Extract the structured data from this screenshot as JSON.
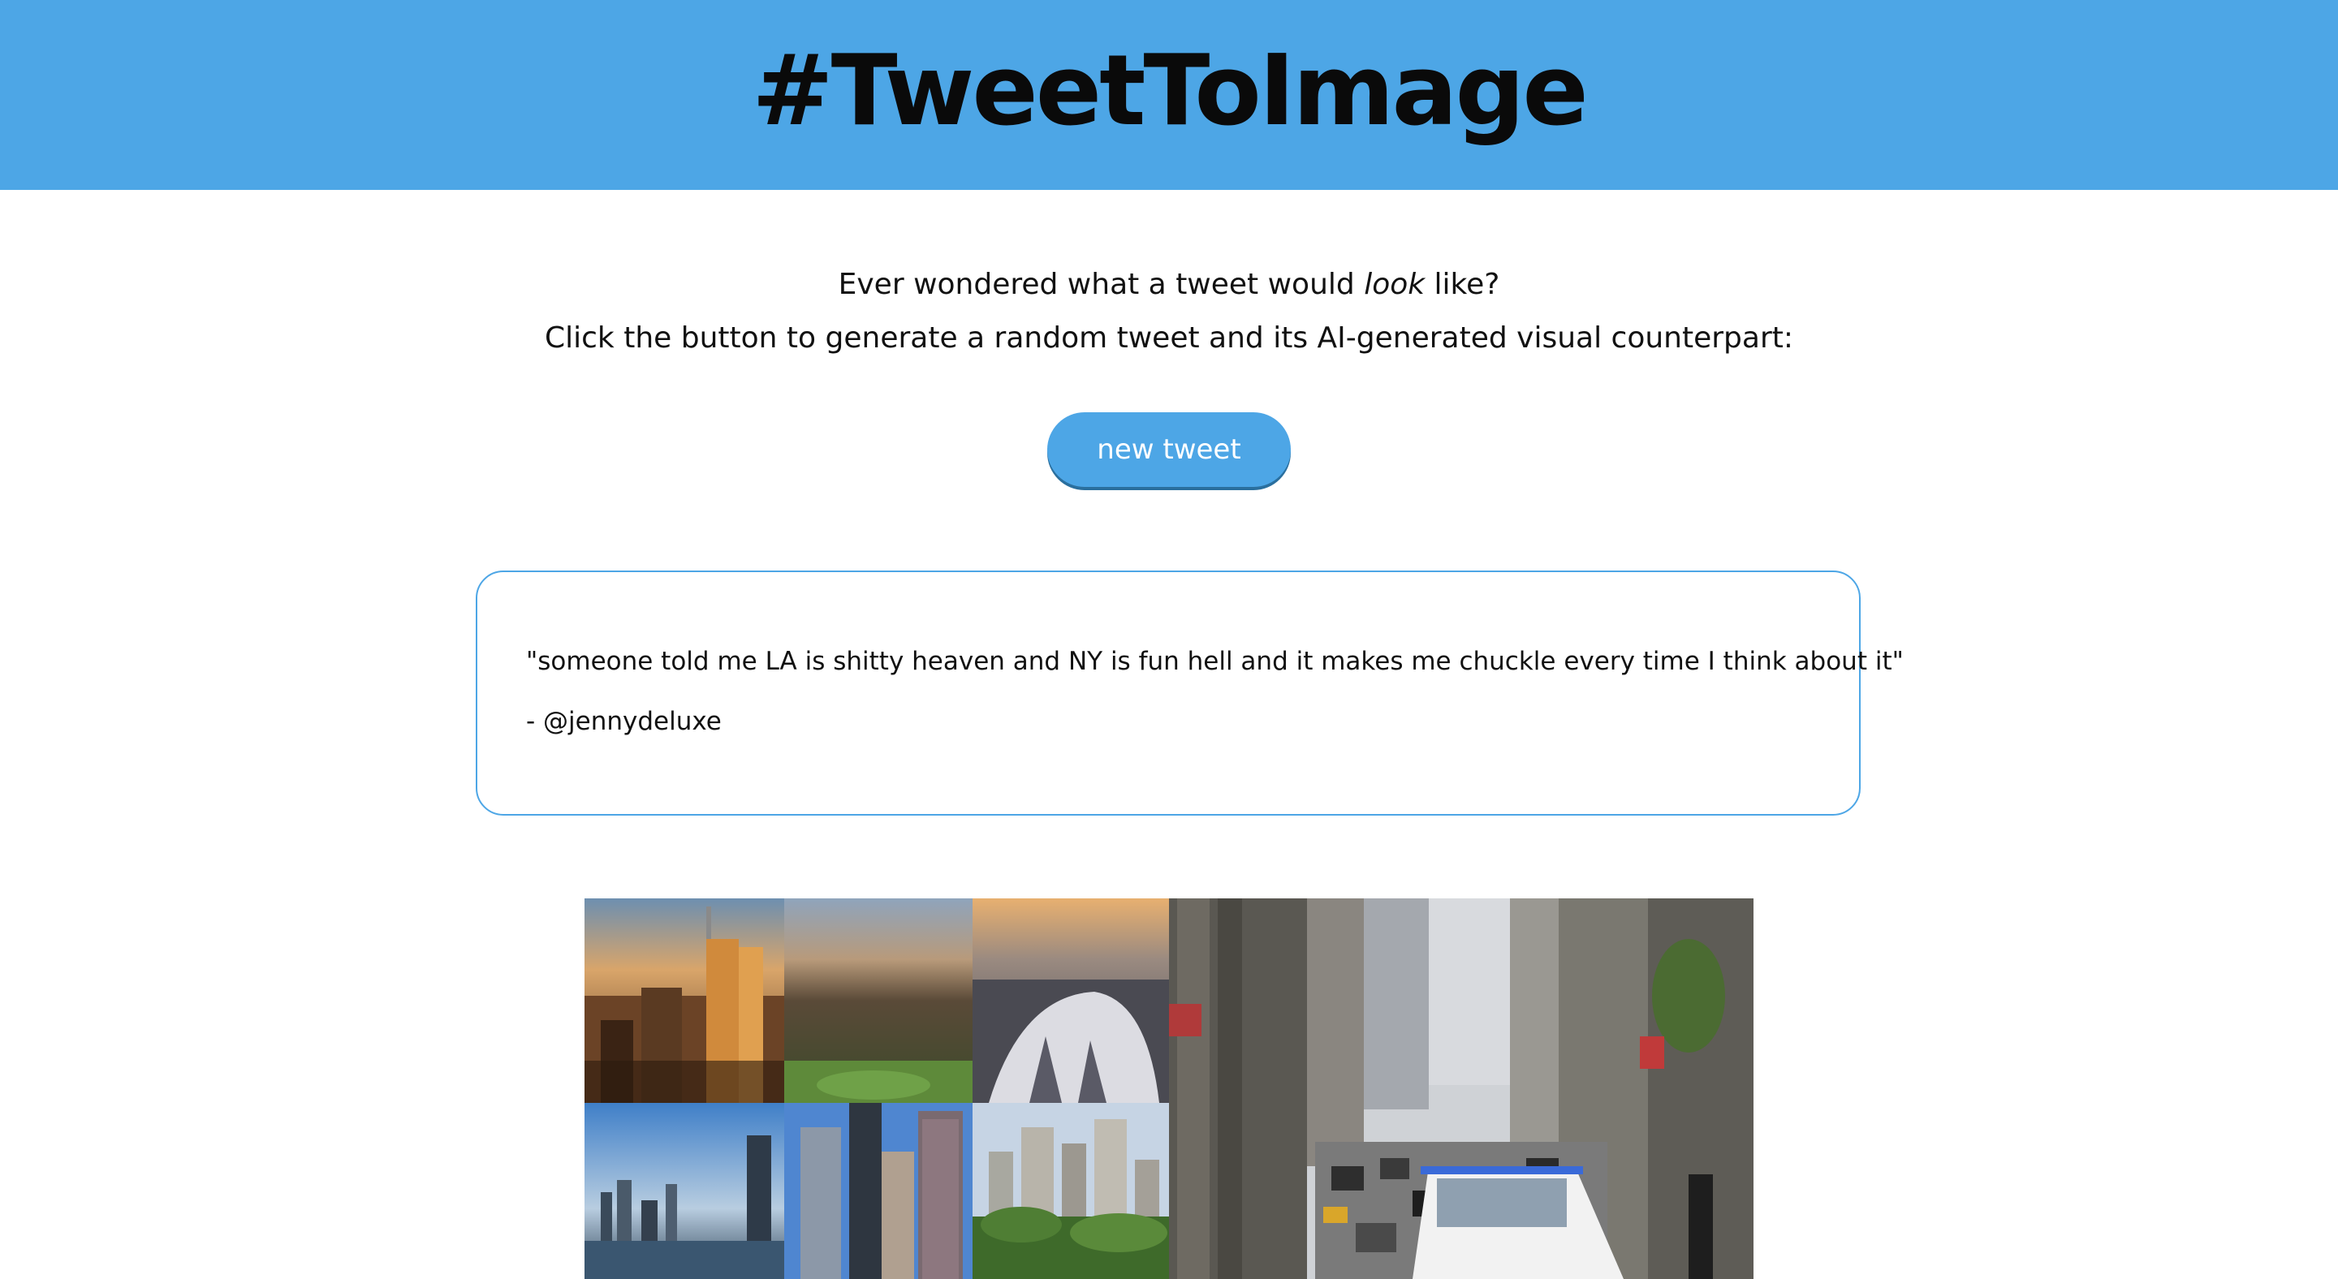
{
  "header": {
    "title": "#TweetToImage"
  },
  "intro": {
    "line1_pre": "Ever wondered what a tweet would ",
    "line1_em": "look",
    "line1_post": " like?",
    "line2": "Click the button to generate a random tweet and its AI-generated visual counterpart:"
  },
  "actions": {
    "new_tweet_label": "new tweet"
  },
  "tweet": {
    "text": "\"someone told me LA is shitty heaven and NY is fun hell and it makes me chuckle every time I think about it\"",
    "author": "- @jennydeluxe"
  },
  "colors": {
    "brand_blue": "#4da6e6",
    "title_text": "#0a0a0a"
  },
  "images": {
    "subjects": [
      "city-skyline-sunset",
      "aerial-city-grid",
      "stadium-dome",
      "waterfront-skyline",
      "glass-skyscrapers",
      "park-skyline",
      "busy-city-street"
    ]
  }
}
